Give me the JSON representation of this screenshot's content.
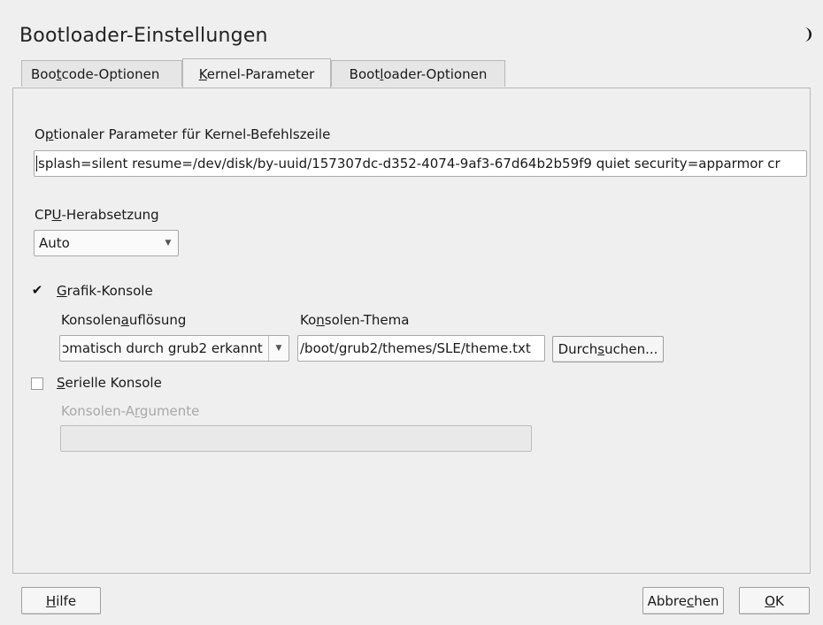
{
  "window": {
    "title": "Bootloader-Einstellungen"
  },
  "tabs": [
    {
      "label_pre": "Boo",
      "label_ul": "t",
      "label_post": "code-Optionen",
      "active": false
    },
    {
      "label_pre": "",
      "label_ul": "K",
      "label_post": "ernel-Parameter",
      "active": true
    },
    {
      "label_pre": "Boot",
      "label_ul": "l",
      "label_post": "oader-Optionen",
      "active": false
    }
  ],
  "kernel": {
    "param_label_pre": "O",
    "param_label_ul": "p",
    "param_label_post": "tionaler Parameter für Kernel-Befehlszeile",
    "param_value": "splash=silent resume=/dev/disk/by-uuid/157307dc-d352-4074-9af3-67d64b2b59f9  quiet security=apparmor cr"
  },
  "cpu": {
    "label_pre": "CP",
    "label_ul": "U",
    "label_post": "-Herabsetzung",
    "selected": "Auto"
  },
  "graphic_console": {
    "checked": true,
    "label_ul": "G",
    "label_post": "rafik-Konsole",
    "resolution_label_pre": "Konsolen",
    "resolution_label_ul": "a",
    "resolution_label_post": "uflösung",
    "resolution_value": "ɔmatisch durch grub2 erkannt",
    "theme_label_pre": "Ko",
    "theme_label_ul": "n",
    "theme_label_post": "solen-Thema",
    "theme_value": "/boot/grub2/themes/SLE/theme.txt",
    "browse_pre": "Durch",
    "browse_ul": "s",
    "browse_post": "uchen..."
  },
  "serial_console": {
    "checked": false,
    "label_ul": "S",
    "label_post": "erielle Konsole",
    "args_label_pre": "Konsolen-A",
    "args_label_ul": "r",
    "args_label_post": "gumente",
    "args_value": ""
  },
  "footer": {
    "help_ul": "H",
    "help_post": "ilfe",
    "cancel_pre": "Abbre",
    "cancel_ul": "c",
    "cancel_post": "hen",
    "ok_ul": "O",
    "ok_post": "K"
  },
  "checkmark_glyph": "✔"
}
